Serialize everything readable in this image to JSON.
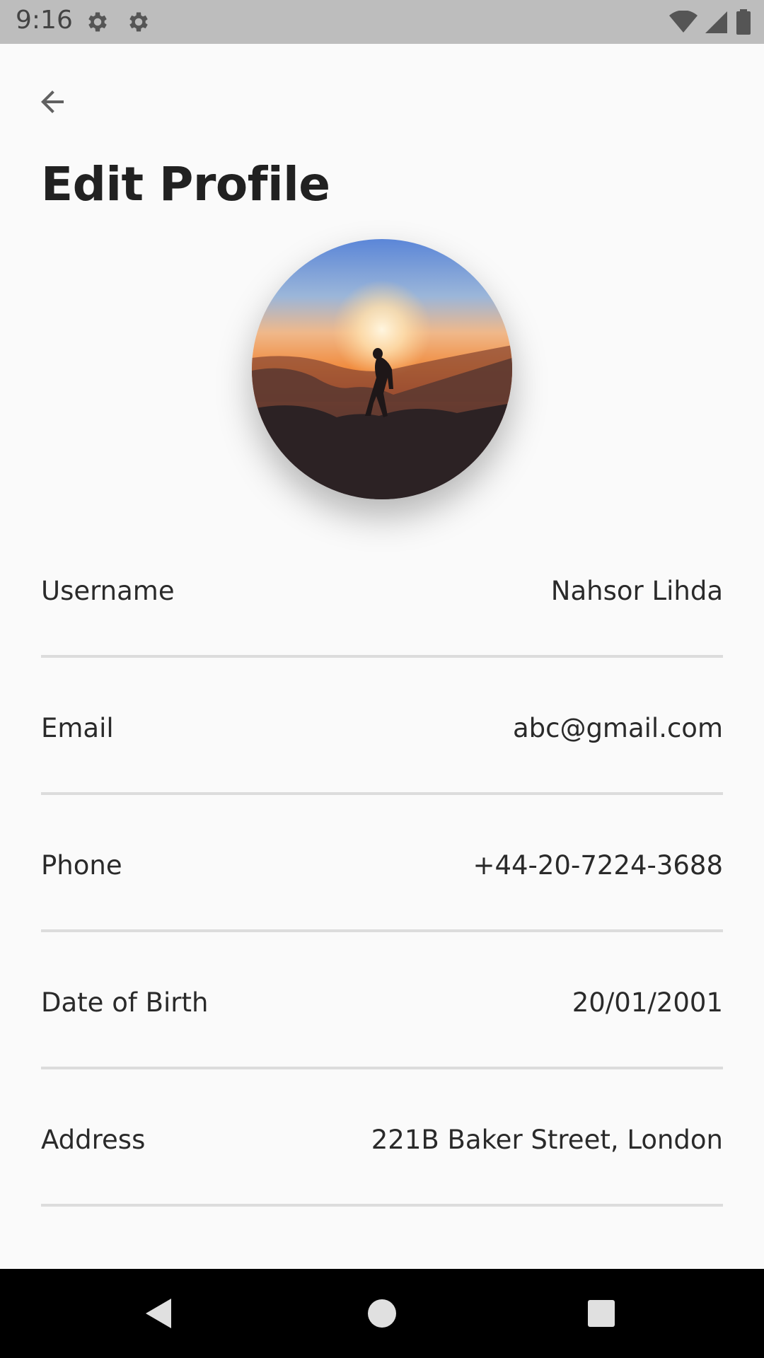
{
  "status_bar": {
    "time": "9:16",
    "icons": [
      "settings-icon",
      "settings-icon",
      "wifi-icon",
      "signal-icon",
      "battery-icon"
    ]
  },
  "header": {
    "back_icon": "arrow-back-icon",
    "title": "Edit Profile"
  },
  "profile": {
    "avatar": "profile-photo-sunset-silhouette"
  },
  "fields": [
    {
      "label": "Username",
      "value": "Nahsor Lihda"
    },
    {
      "label": "Email",
      "value": "abc@gmail.com"
    },
    {
      "label": "Phone",
      "value": "+44-20-7224-3688"
    },
    {
      "label": "Date of Birth",
      "value": "20/01/2001"
    },
    {
      "label": "Address",
      "value": "221B Baker Street, London"
    }
  ],
  "nav_bar": {
    "icons": [
      "nav-back-icon",
      "nav-home-icon",
      "nav-recents-icon"
    ]
  },
  "colors": {
    "background": "#fafafa",
    "status_bar": "#bdbdbd",
    "divider": "#dcdcdc",
    "text": "#212121",
    "nav_bar": "#000000"
  }
}
